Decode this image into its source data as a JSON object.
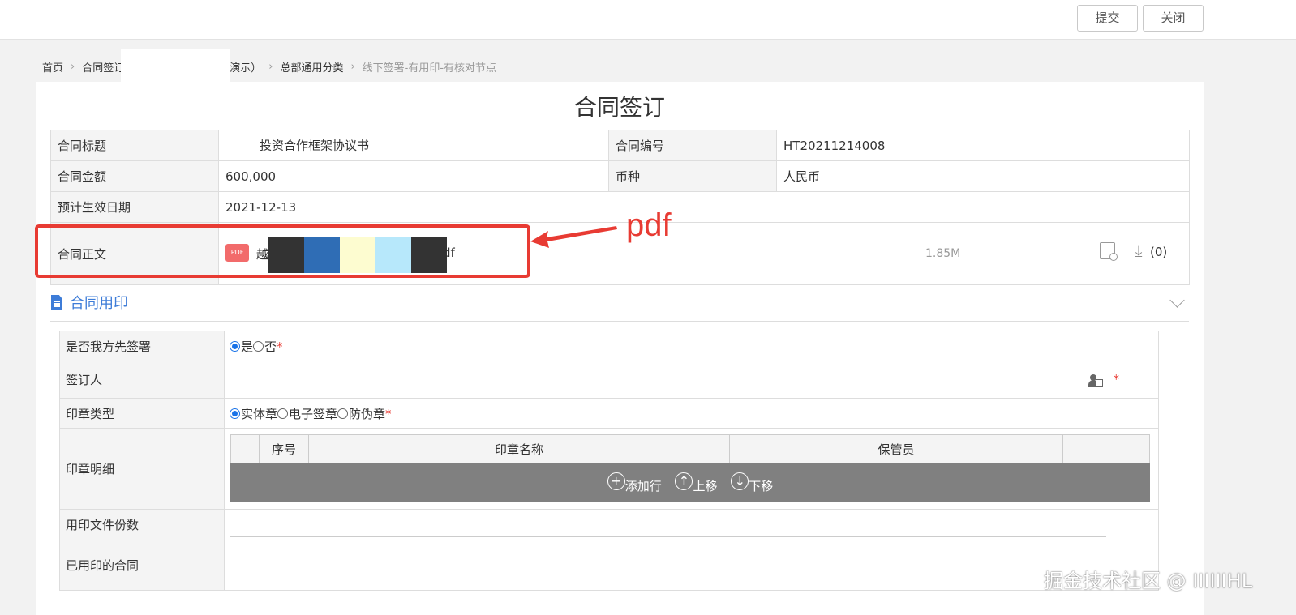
{
  "topbar": {
    "submit_label": "提交",
    "close_label": "关闭"
  },
  "breadcrumb": {
    "home": "首页",
    "item2": "合同签订",
    "item3": "演示）",
    "item4": "总部通用分类",
    "current": "线下签署-有用印-有核对节点"
  },
  "page_title": "合同签订",
  "contract": {
    "title_label": "合同标题",
    "title_value": "投资合作框架协议书",
    "number_label": "合同编号",
    "number_value": "HT20211214008",
    "amount_label": "合同金额",
    "amount_value": "600,000",
    "currency_label": "币种",
    "currency_value": "人民币",
    "date_label": "预计生效日期",
    "date_value": "2021-12-13",
    "body_label": "合同正文",
    "file_icon": "PDF",
    "file_name_start": "越",
    "file_name_end": "df",
    "file_size": "1.85M",
    "download_count": "(0)"
  },
  "annotation": {
    "note": "pdf",
    "color": "#e83b33"
  },
  "seal_section": {
    "title": "合同用印",
    "first_sign_label": "是否我方先签署",
    "yes": "是",
    "no": "否",
    "signer_label": "签订人",
    "seal_type_label": "印章类型",
    "seal_types": [
      "实体章",
      "电子签章",
      "防伪章"
    ],
    "seal_detail_label": "印章明细",
    "columns": [
      "序号",
      "印章名称",
      "保管员"
    ],
    "ops": [
      "添加行",
      "上移",
      "下移"
    ],
    "copies_label": "用印文件份数",
    "stamped_label": "已用印的合同",
    "required_mark": "*"
  },
  "watermark": "掘金技术社区 @ IIIIIIHL",
  "colors": {
    "accent": "#3d7cd8",
    "radio": "#1a73e8",
    "redact_dark": "#333333",
    "redact_blue": "#2f6db5",
    "redact_yellow": "#fdfcd0",
    "redact_cyan": "#b7e8fb"
  }
}
